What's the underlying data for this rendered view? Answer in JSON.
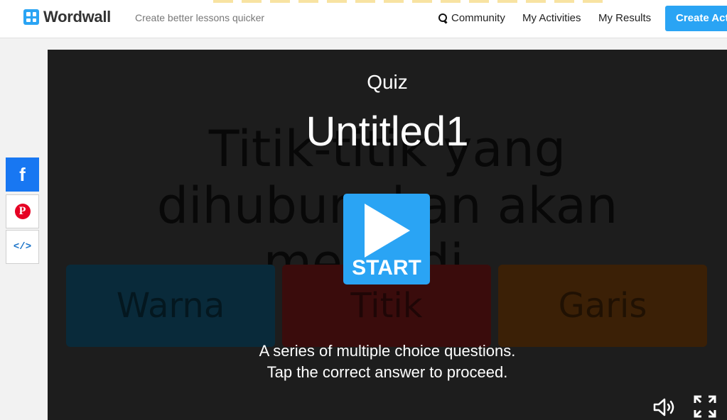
{
  "header": {
    "logo_text": "Wordwall",
    "tagline": "Create better lessons quicker",
    "nav": {
      "community": "Community",
      "my_activities": "My Activities",
      "my_results": "My Results",
      "create_activity": "Create Activity"
    }
  },
  "share": {
    "facebook_glyph": "f",
    "pinterest_glyph": "P",
    "embed_glyph": "</>"
  },
  "activity": {
    "type": "Quiz",
    "title": "Untitled1",
    "start_label": "START",
    "description_line1": "A series of multiple choice questions.",
    "description_line2": "Tap the correct answer to proceed.",
    "background_question": "Titik-titik yang dihubungkan akan menjadi...",
    "answers": [
      "Warna",
      "Titik",
      "Garis"
    ]
  },
  "colors": {
    "accent": "#2aa4f4",
    "facebook": "#1877f2",
    "pinterest": "#e60023",
    "stage_bg": "#1d1d1d"
  }
}
